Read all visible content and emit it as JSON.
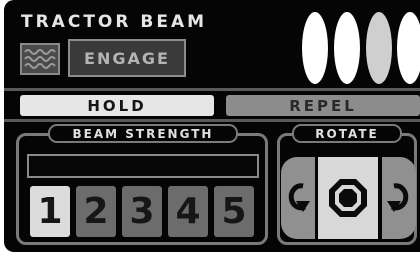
{
  "header": {
    "title": "TRACTOR BEAM",
    "engage_label": "ENGAGE",
    "wave_icon": "wave-icon"
  },
  "status_lights": [
    {
      "color": "#ffffff"
    },
    {
      "color": "#ffffff"
    },
    {
      "color": "#cfcfcf"
    },
    {
      "color": "#ffffff"
    }
  ],
  "modes": {
    "hold_label": "HOLD",
    "repel_label": "REPEL",
    "selected": "HOLD"
  },
  "beam_strength": {
    "label": "BEAM STRENGTH",
    "fill_fraction": 0,
    "levels": [
      "1",
      "2",
      "3",
      "4",
      "5"
    ],
    "selected_level": "1"
  },
  "rotate": {
    "label": "ROTATE",
    "left_icon": "rotate-ccw-icon",
    "center_icon": "stop-icon",
    "right_icon": "rotate-cw-icon"
  }
}
